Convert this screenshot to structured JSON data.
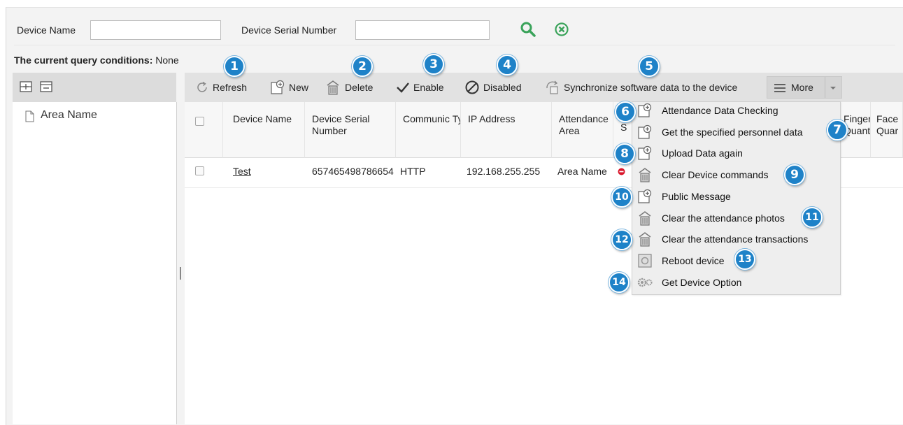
{
  "query": {
    "device_name_label": "Device Name",
    "device_name_value": "",
    "serial_label": "Device Serial Number",
    "serial_value": "",
    "conditions_label": "The current query conditions:",
    "conditions_value": "None"
  },
  "tree": {
    "root_label": "Area Name"
  },
  "toolbar": {
    "refresh": "Refresh",
    "new": "New",
    "delete": "Delete",
    "enable": "Enable",
    "disabled": "Disabled",
    "sync": "Synchronize software data to the device",
    "more": "More"
  },
  "table": {
    "headers": [
      "Device Name",
      "Device Serial Number",
      "Communication Type",
      "IP Address",
      "Attendance Area",
      "S",
      "Finger Quant",
      "Face Quar"
    ],
    "header_display": {
      "device_name": "Device Name",
      "serial": "Device Serial Number",
      "comm": "Communic Type",
      "ip": "IP Address",
      "area": "Attendance Area",
      "status": "S",
      "finger": "Finger Quant",
      "face": "Face Quar"
    },
    "rows": [
      {
        "device_name": "Test",
        "serial": "657465498786654",
        "comm": "HTTP",
        "ip": "192.168.255.255",
        "area": "Area Name"
      }
    ]
  },
  "more_menu": [
    {
      "label": "Attendance Data Checking",
      "icon": "add-document-icon"
    },
    {
      "label": "Get the specified personnel data",
      "icon": "add-document-icon"
    },
    {
      "label": "Upload Data again",
      "icon": "add-document-icon"
    },
    {
      "label": "Clear Device commands",
      "icon": "trash-icon"
    },
    {
      "label": "Public Message",
      "icon": "add-document-icon"
    },
    {
      "label": "Clear the attendance photos",
      "icon": "trash-icon"
    },
    {
      "label": "Clear the attendance transactions",
      "icon": "trash-icon"
    },
    {
      "label": "Reboot device",
      "icon": "reboot-icon"
    },
    {
      "label": "Get Device Option",
      "icon": "gears-icon"
    }
  ],
  "badges": [
    "1",
    "2",
    "3",
    "4",
    "5",
    "6",
    "7",
    "8",
    "9",
    "10",
    "11",
    "12",
    "13",
    "14"
  ],
  "colors": {
    "badge": "#1e82c8",
    "search_icon": "#3aa35a",
    "status_disabled": "#d9152a"
  }
}
